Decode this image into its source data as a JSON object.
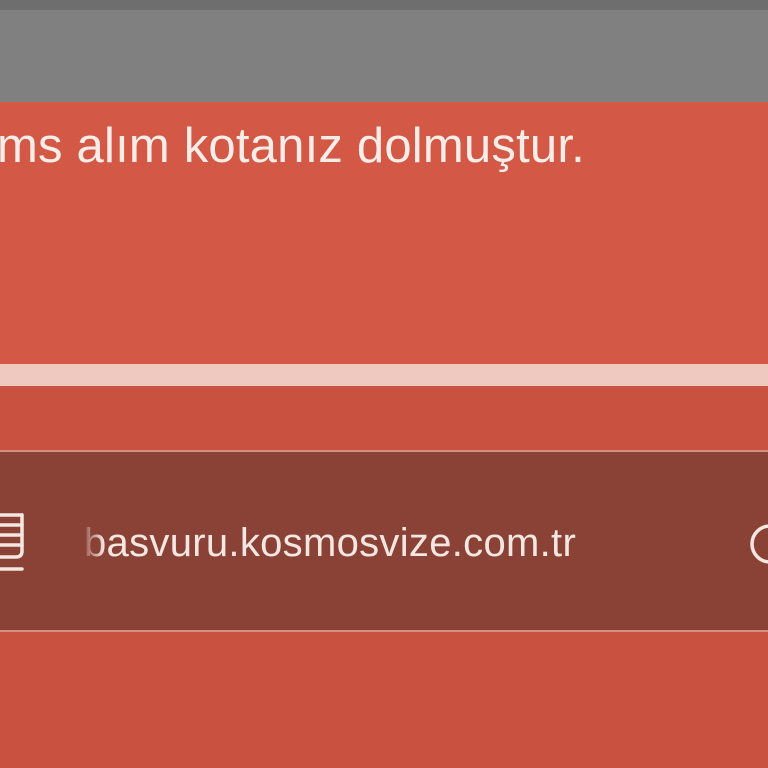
{
  "banner": {
    "message": "ms alım kotanız dolmuştur."
  },
  "address_bar": {
    "url": "basvuru.kosmosvize.com.tr",
    "left_icon": "reader-mode-icon",
    "right_icon": "reload-icon"
  },
  "colors": {
    "banner_bg": "#d35946",
    "toolbar_bg": "#c9513f",
    "address_bar_bg": "#8a4237",
    "top_bar_bg": "#808080",
    "text": "#f7ede8"
  }
}
